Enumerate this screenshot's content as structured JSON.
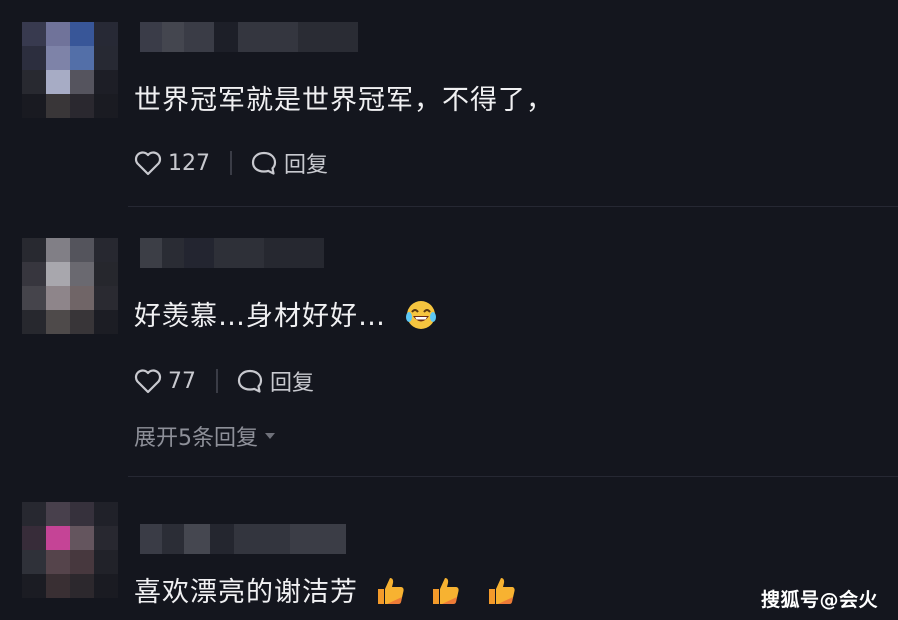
{
  "comments": [
    {
      "text": "世界冠军就是世界冠军，不得了，",
      "likes": "127",
      "reply_label": "回复"
    },
    {
      "text": "好羡慕…身材好好…",
      "likes": "77",
      "reply_label": "回复",
      "expand_label": "展开5条回复"
    },
    {
      "text": "喜欢漂亮的谢洁芳"
    }
  ],
  "watermark": "搜狐号@会火",
  "icons": [
    "heart-icon",
    "comment-bubble-icon",
    "chevron-down-icon",
    "laughing-tears-emoji-icon",
    "thumbs-up-emoji-icon"
  ],
  "colors": {
    "background": "#14161e",
    "text": "#f0f0f2",
    "muted": "#8e9099"
  }
}
